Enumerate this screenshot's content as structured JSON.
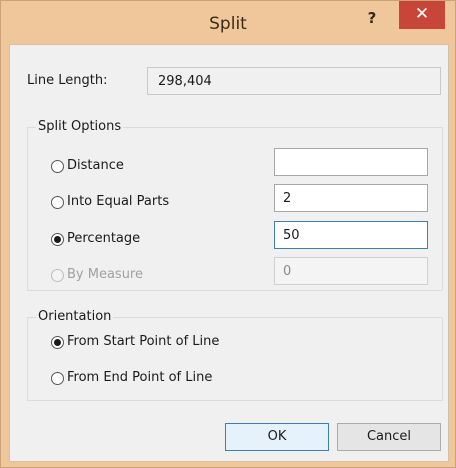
{
  "window": {
    "title": "Split",
    "help_label": "?",
    "close_label": "✕"
  },
  "line_length": {
    "label": "Line Length:",
    "value": "298,404"
  },
  "split_options": {
    "title": "Split Options",
    "options": [
      {
        "label": "Distance",
        "value": "",
        "checked": false,
        "disabled": false
      },
      {
        "label": "Into Equal Parts",
        "value": "2",
        "checked": false,
        "disabled": false
      },
      {
        "label": "Percentage",
        "value": "50",
        "checked": true,
        "disabled": false
      },
      {
        "label": "By Measure",
        "value": "0",
        "checked": false,
        "disabled": true
      }
    ]
  },
  "orientation": {
    "title": "Orientation",
    "options": [
      {
        "label": "From Start Point of Line",
        "checked": true
      },
      {
        "label": "From End Point of Line",
        "checked": false
      }
    ]
  },
  "buttons": {
    "ok": "OK",
    "cancel": "Cancel"
  }
}
